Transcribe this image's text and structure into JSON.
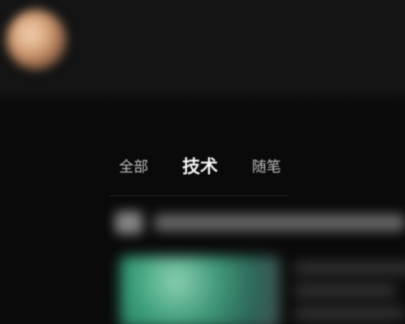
{
  "profile": {
    "username": "",
    "avatar_icon": "avatar-image"
  },
  "tabs": [
    {
      "label": "全部",
      "active": false
    },
    {
      "label": "技术",
      "active": true
    },
    {
      "label": "随笔",
      "active": false
    }
  ],
  "post": {
    "title": "",
    "excerpt": "",
    "thumbnail_icon": "post-thumbnail-image"
  },
  "colors": {
    "background": "#0b0b0b",
    "header_background": "#141414",
    "tab_active": "#f4f4f4",
    "tab_inactive": "#bdbdbd"
  }
}
